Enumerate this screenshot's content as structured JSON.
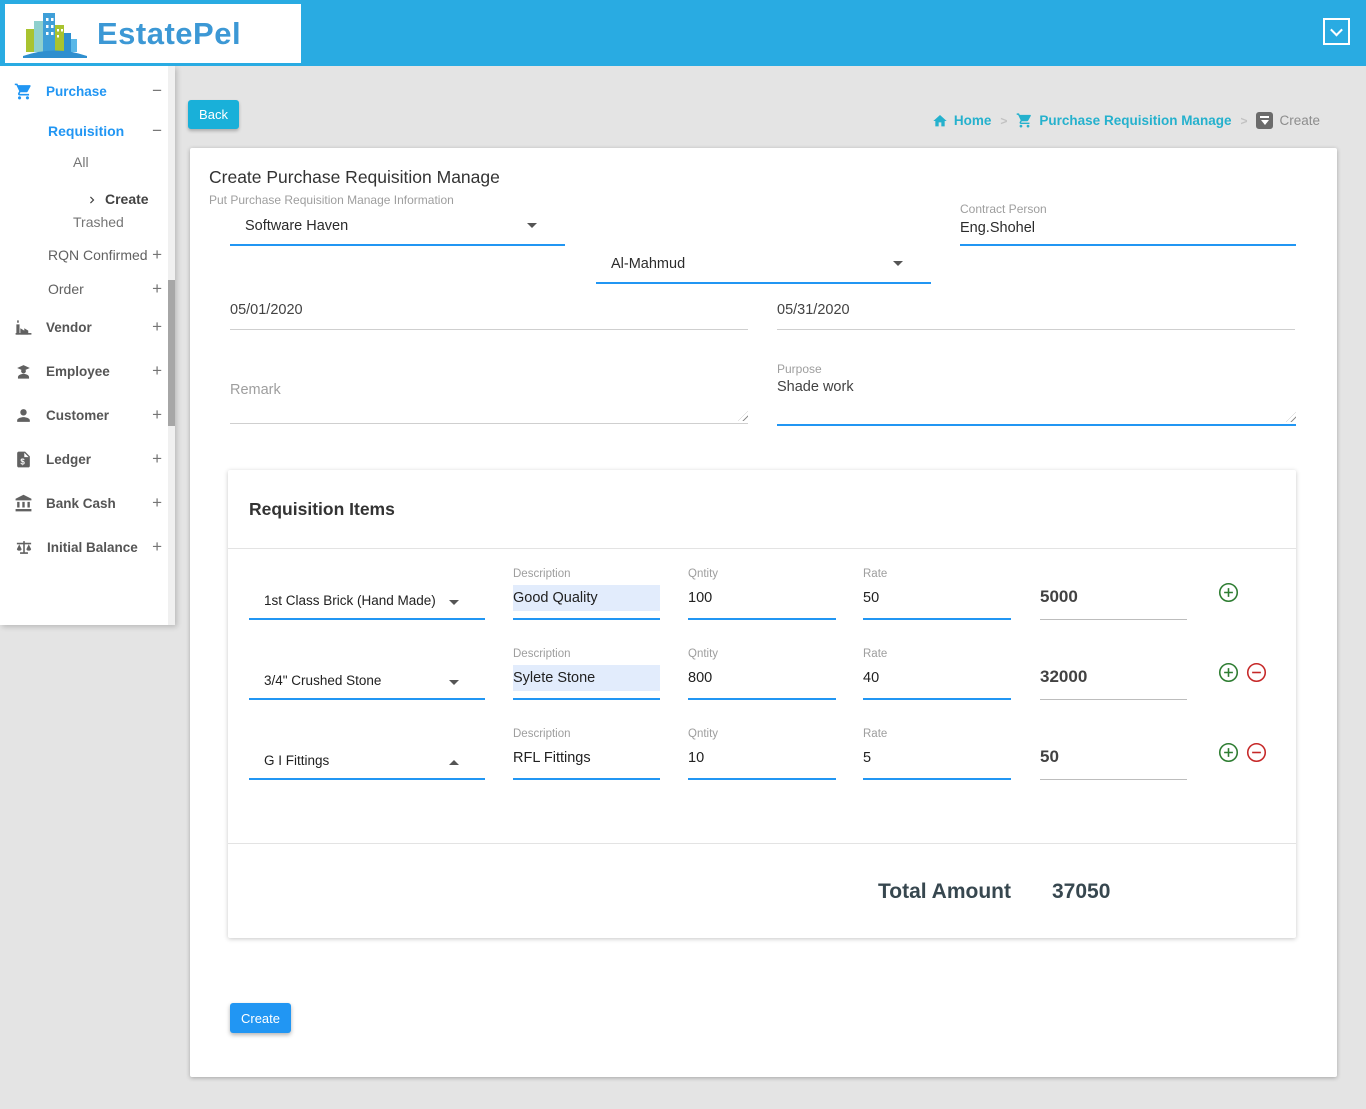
{
  "theme": {
    "header_bg": "#29abe2",
    "primary_blue": "#2196f3",
    "breadcrumb_link": "#25b1cd",
    "plus_green": "#2e7d32",
    "minus_red": "#c62828"
  },
  "header": {
    "brand": "EstatePel"
  },
  "sidebar": {
    "items": [
      {
        "label": "Purchase",
        "toggle": "−"
      },
      {
        "label": "Requisition",
        "toggle": "−"
      },
      {
        "label": "All"
      },
      {
        "label": "Create"
      },
      {
        "label": "Trashed"
      },
      {
        "label": "RQN Confirmed",
        "toggle": "+"
      },
      {
        "label": "Order",
        "toggle": "+"
      },
      {
        "label": "Vendor",
        "toggle": "+"
      },
      {
        "label": "Employee",
        "toggle": "+"
      },
      {
        "label": "Customer",
        "toggle": "+"
      },
      {
        "label": "Ledger",
        "toggle": "+"
      },
      {
        "label": "Bank Cash",
        "toggle": "+"
      },
      {
        "label": "Initial Balance",
        "toggle": "+"
      }
    ]
  },
  "toolbar": {
    "back_label": "Back"
  },
  "breadcrumb": {
    "home": "Home",
    "section": "Purchase Requisition Manage",
    "current": "Create"
  },
  "form": {
    "title": "Create Purchase Requisition Manage",
    "subtitle": "Put Purchase Requisition Manage Information",
    "company": {
      "value": "Software Haven"
    },
    "requested_by": {
      "value": "Al-Mahmud"
    },
    "contract_person": {
      "label": "Contract Person",
      "value": "Eng.Shohel"
    },
    "start_date": "05/01/2020",
    "end_date": "05/31/2020",
    "remark": {
      "placeholder": "Remark"
    },
    "purpose": {
      "label": "Purpose",
      "value": "Shade work"
    }
  },
  "items": {
    "title": "Requisition Items",
    "labels": {
      "description": "Description",
      "qty": "Qntity",
      "rate": "Rate"
    },
    "rows": [
      {
        "item": "1st Class Brick (Hand Made)",
        "description": "Good Quality",
        "qty": "100",
        "rate": "50",
        "amount": "5000"
      },
      {
        "item": "3/4\" Crushed Stone",
        "description": "Sylete Stone",
        "qty": "800",
        "rate": "40",
        "amount": "32000"
      },
      {
        "item": "G I Fittings",
        "description": "RFL Fittings",
        "qty": "10",
        "rate": "5",
        "amount": "50"
      }
    ],
    "total_label": "Total Amount",
    "total_value": "37050"
  },
  "actions": {
    "create_label": "Create"
  }
}
